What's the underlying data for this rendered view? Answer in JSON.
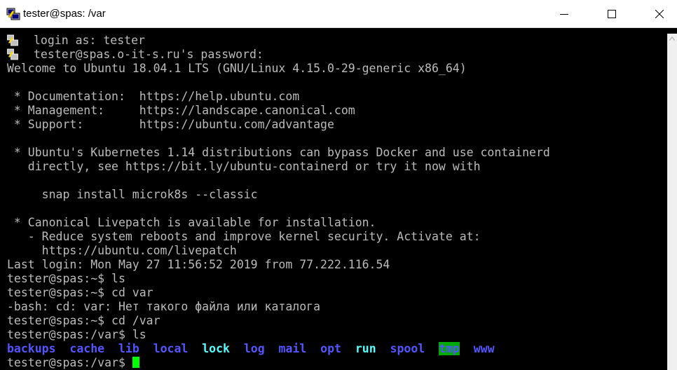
{
  "window": {
    "title": "tester@spas: /var"
  },
  "terminal": {
    "lines": [
      "login as: tester",
      "tester@spas.o-it-s.ru's password:",
      "Welcome to Ubuntu 18.04.1 LTS (GNU/Linux 4.15.0-29-generic x86_64)",
      "",
      " * Documentation:  https://help.ubuntu.com",
      " * Management:     https://landscape.canonical.com",
      " * Support:        https://ubuntu.com/advantage",
      "",
      " * Ubuntu's Kubernetes 1.14 distributions can bypass Docker and use containerd",
      "   directly, see https://bit.ly/ubuntu-containerd or try it now with",
      "",
      "     snap install microk8s --classic",
      "",
      " * Canonical Livepatch is available for installation.",
      "   - Reduce system reboots and improve kernel security. Activate at:",
      "     https://ubuntu.com/livepatch",
      "Last login: Mon May 27 11:56:52 2019 from 77.222.116.54",
      "tester@spas:~$ ls",
      "tester@spas:~$ cd var",
      "-bash: cd: var: Нет такого файла или каталога",
      "tester@spas:~$ cd /var",
      "tester@spas:/var$ ls"
    ],
    "ls_output": [
      "backups",
      "cache",
      "lib",
      "local",
      "lock",
      "log",
      "mail",
      "opt",
      "run",
      "spool",
      "tmp",
      "www"
    ],
    "prompt": "tester@spas:/var$ "
  },
  "colors": {
    "background": "#000000",
    "foreground": "#bbbbbb",
    "directory": "#5555ff",
    "symlink": "#55ffff",
    "tmp_highlight": "#00aa00",
    "cursor": "#00ff00"
  }
}
